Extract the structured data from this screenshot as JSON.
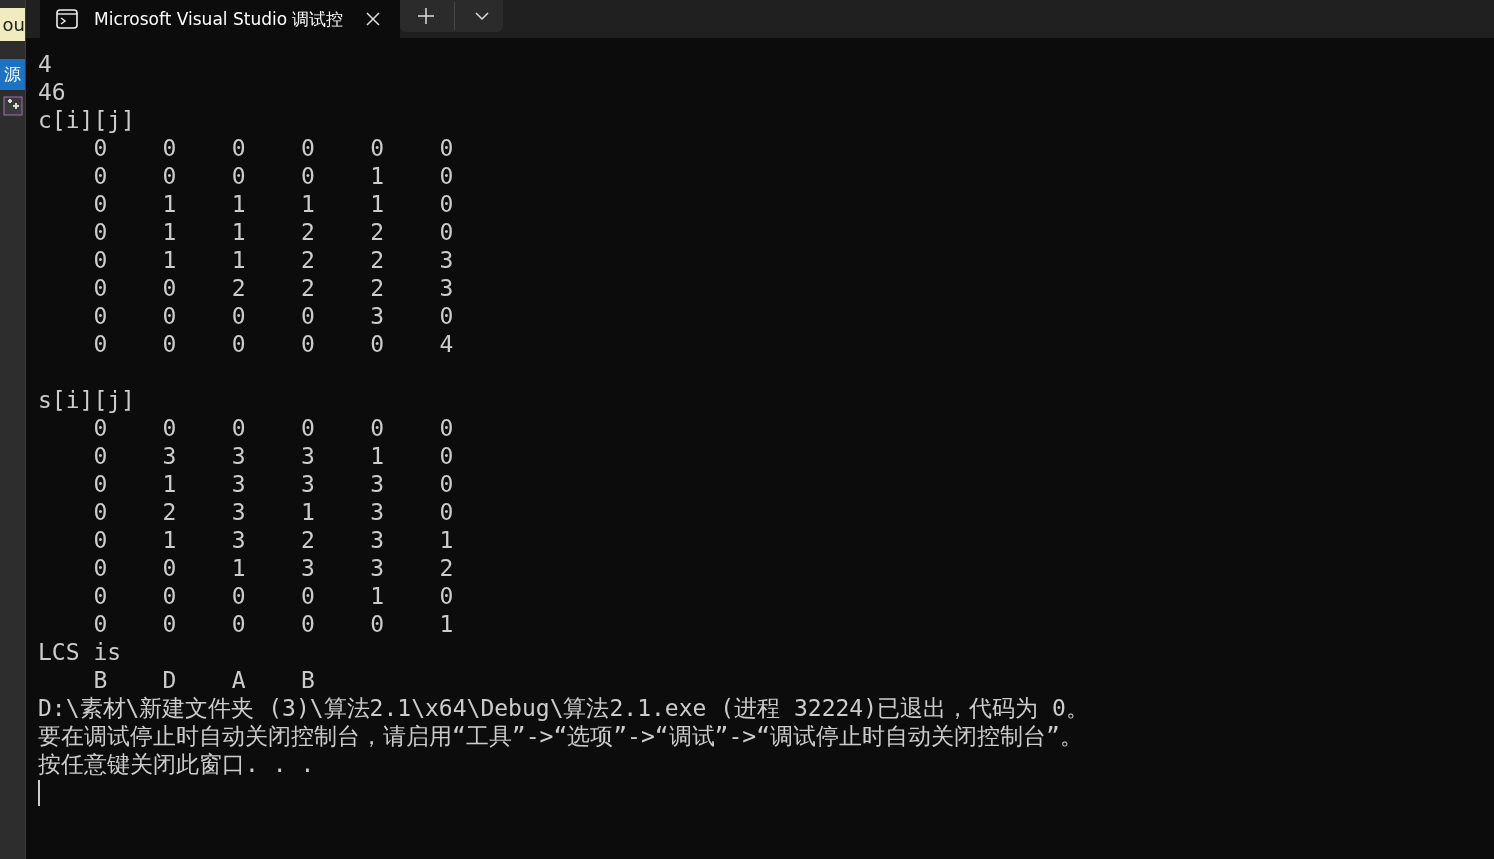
{
  "background_window": {
    "items": [
      {
        "kind": "tooltip",
        "label": "ou"
      },
      {
        "kind": "tab",
        "label": "源"
      },
      {
        "kind": "icon"
      }
    ]
  },
  "tabs": [
    {
      "title": "Microsoft Visual Studio 调试控",
      "selected": true
    }
  ],
  "console": {
    "blocks": [
      [
        "4",
        "46",
        "c[i][j]",
        "    0    0    0    0    0    0",
        "    0    0    0    0    1    0",
        "    0    1    1    1    1    0",
        "    0    1    1    2    2    0",
        "    0    1    1    2    2    3",
        "    0    0    2    2    2    3",
        "    0    0    0    0    3    0",
        "    0    0    0    0    0    4"
      ],
      [
        "s[i][j]",
        "    0    0    0    0    0    0",
        "    0    3    3    3    1    0",
        "    0    1    3    3    3    0",
        "    0    2    3    1    3    0",
        "    0    1    3    2    3    1",
        "    0    0    1    3    3    2",
        "    0    0    0    0    1    0",
        "    0    0    0    0    0    1",
        "LCS is",
        "    B    D    A    B",
        "D:\\素材\\新建文件夹 (3)\\算法2.1\\x64\\Debug\\算法2.1.exe (进程 32224)已退出，代码为 0。",
        "要在调试停止时自动关闭控制台，请启用“工具”->“选项”->“调试”->“调试停止时自动关闭控制台”。",
        "按任意键关闭此窗口. . ."
      ]
    ],
    "cursor": true
  }
}
